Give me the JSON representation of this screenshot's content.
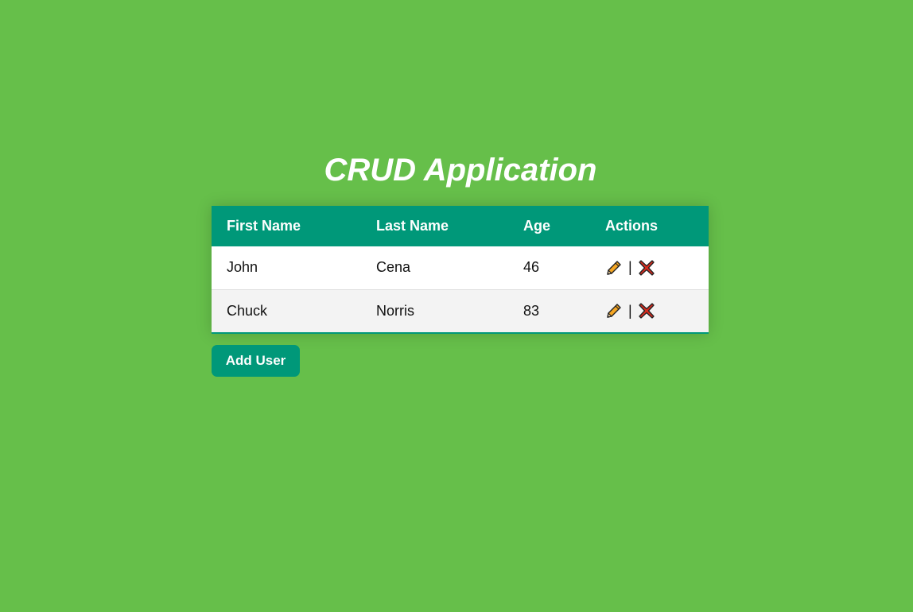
{
  "page": {
    "title": "CRUD Application",
    "background_color": "#66bf4a",
    "accent_color": "#009879"
  },
  "table": {
    "headers": [
      "First Name",
      "Last Name",
      "Age",
      "Actions"
    ],
    "rows": [
      {
        "first_name": "John",
        "last_name": "Cena",
        "age": "46",
        "separator": "|",
        "edit_icon": "pencil-icon",
        "delete_icon": "cross-mark-icon"
      },
      {
        "first_name": "Chuck",
        "last_name": "Norris",
        "age": "83",
        "separator": "|",
        "edit_icon": "pencil-icon",
        "delete_icon": "cross-mark-icon"
      }
    ]
  },
  "add_button": {
    "label": "Add User"
  }
}
